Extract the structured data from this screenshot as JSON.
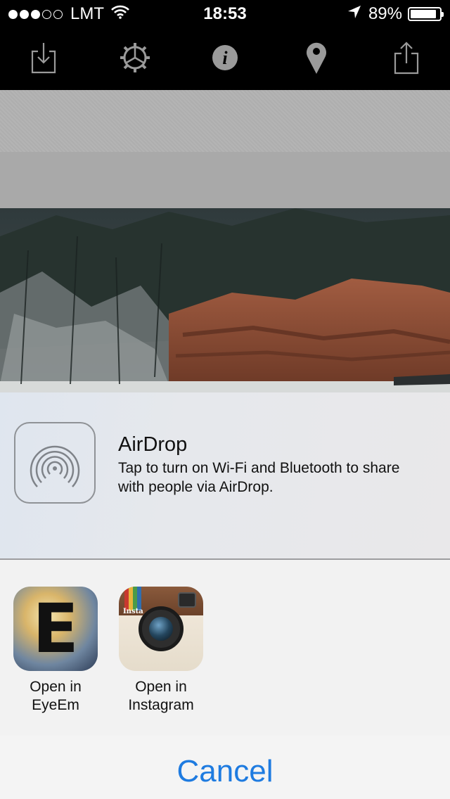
{
  "status_bar": {
    "carrier": "LMT",
    "time": "18:53",
    "battery": "89%",
    "battery_level": 0.89,
    "signal_bars": 3,
    "signal_total": 5
  },
  "toolbar": {
    "icons": [
      "download-icon",
      "settings-icon",
      "info-icon",
      "location-pin-icon",
      "share-icon"
    ]
  },
  "airdrop": {
    "title": "AirDrop",
    "description": "Tap to turn on Wi-Fi and Bluetooth to share with people via AirDrop."
  },
  "apps": [
    {
      "label": "Open in\nEyeEm",
      "icon": "eyeem-icon"
    },
    {
      "label": "Open in\nInstagram",
      "icon": "instagram-icon"
    }
  ],
  "instagram_badge": "Insta",
  "cancel_label": "Cancel",
  "colors": {
    "accent": "#1e7be0",
    "toolbar_bg": "#000000"
  }
}
